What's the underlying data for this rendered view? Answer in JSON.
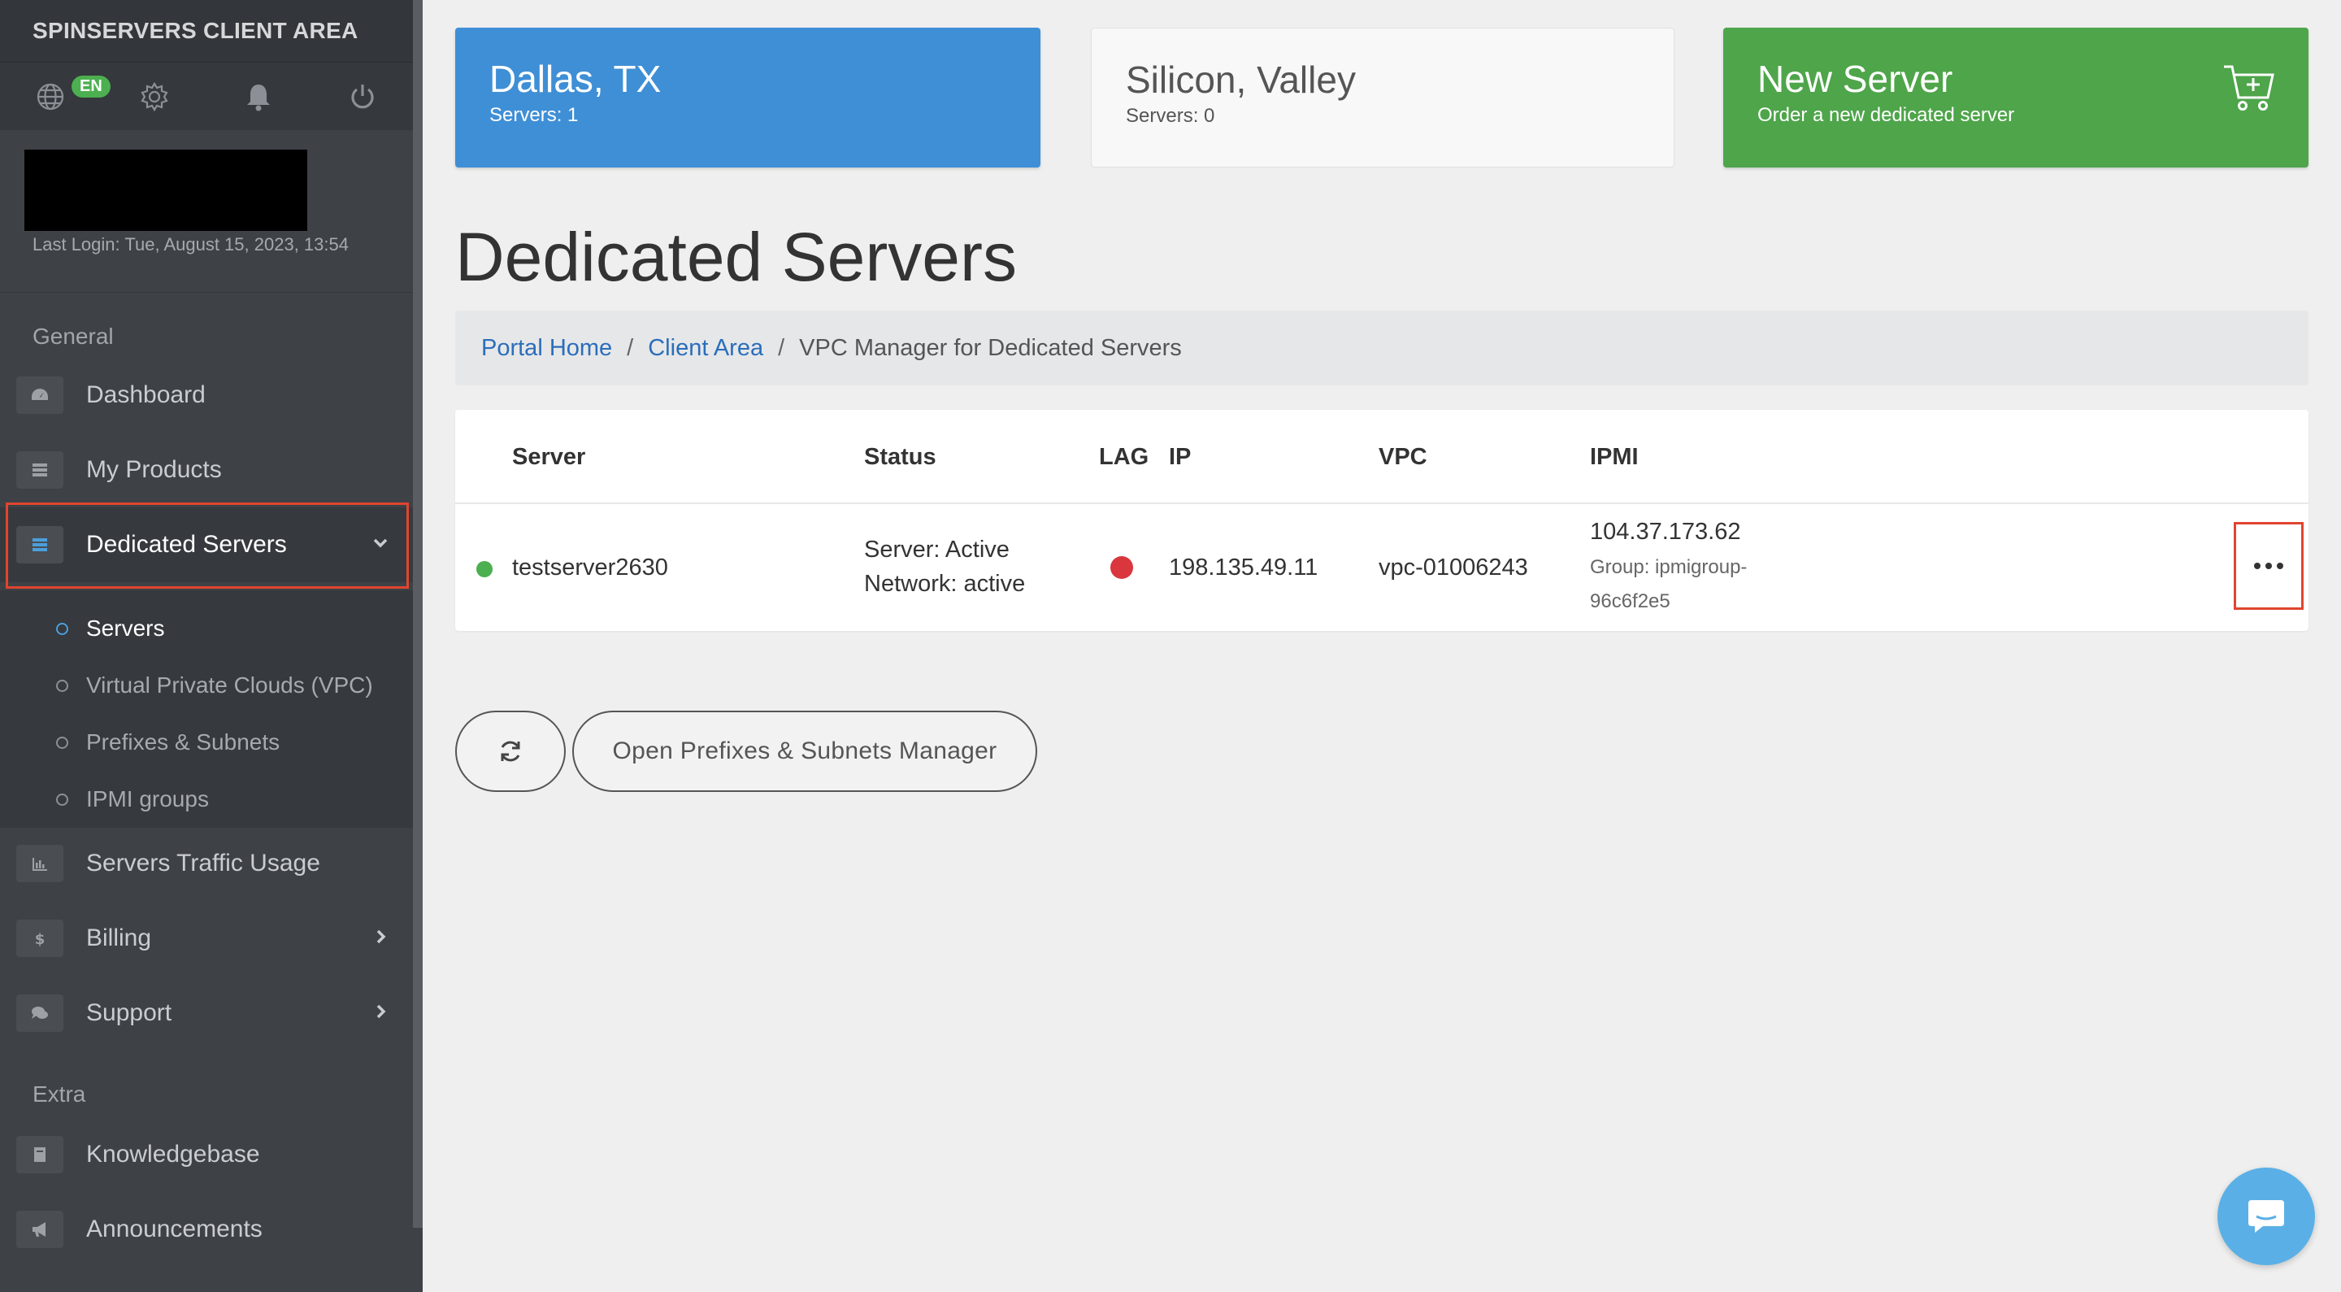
{
  "sidebar": {
    "brand": "SPINSERVERS CLIENT AREA",
    "language_badge": "EN",
    "last_login": "Last Login: Tue, August 15, 2023, 13:54",
    "sections": {
      "general": "General",
      "extra": "Extra"
    },
    "items": [
      {
        "label": "Dashboard",
        "icon": "dashboard-icon"
      },
      {
        "label": "My Products",
        "icon": "products-icon"
      },
      {
        "label": "Dedicated Servers",
        "icon": "server-icon",
        "active": true
      },
      {
        "label": "Servers Traffic Usage",
        "icon": "chart-icon"
      },
      {
        "label": "Billing",
        "icon": "dollar-icon"
      },
      {
        "label": "Support",
        "icon": "chat-bubbles-icon"
      },
      {
        "label": "Knowledgebase",
        "icon": "book-icon"
      },
      {
        "label": "Announcements",
        "icon": "megaphone-icon"
      }
    ],
    "submenu": [
      {
        "label": "Servers",
        "active": true
      },
      {
        "label": "Virtual Private Clouds (VPC)"
      },
      {
        "label": "Prefixes & Subnets"
      },
      {
        "label": "IPMI groups"
      }
    ]
  },
  "cards": {
    "dallas": {
      "title": "Dallas, TX",
      "sub": "Servers: 1"
    },
    "silicon": {
      "title": "Silicon, Valley",
      "sub": "Servers: 0"
    },
    "new_server": {
      "title": "New Server",
      "sub": "Order a new dedicated server"
    }
  },
  "page_title": "Dedicated Servers",
  "breadcrumb": {
    "items": [
      "Portal Home",
      "Client Area",
      "VPC Manager for Dedicated Servers"
    ],
    "separator": "/"
  },
  "table": {
    "headers": [
      "Server",
      "Status",
      "LAG",
      "IP",
      "VPC",
      "IPMI"
    ],
    "rows": [
      {
        "server": "testserver2630",
        "status_server": "Server: Active",
        "status_network": "Network: active",
        "lag_color": "#d9363e",
        "ip": "198.135.49.11",
        "vpc": "vpc-01006243",
        "ipmi_ip": "104.37.173.62",
        "ipmi_group_1": "Group: ipmigroup-",
        "ipmi_group_2": "96c6f2e5"
      }
    ]
  },
  "buttons": {
    "open_prefixes": "Open Prefixes & Subnets Manager"
  },
  "colors": {
    "accent_blue": "#3f8fd6",
    "accent_green": "#4ea54a",
    "highlight_red": "#e0452f",
    "status_green": "#4caf50"
  }
}
